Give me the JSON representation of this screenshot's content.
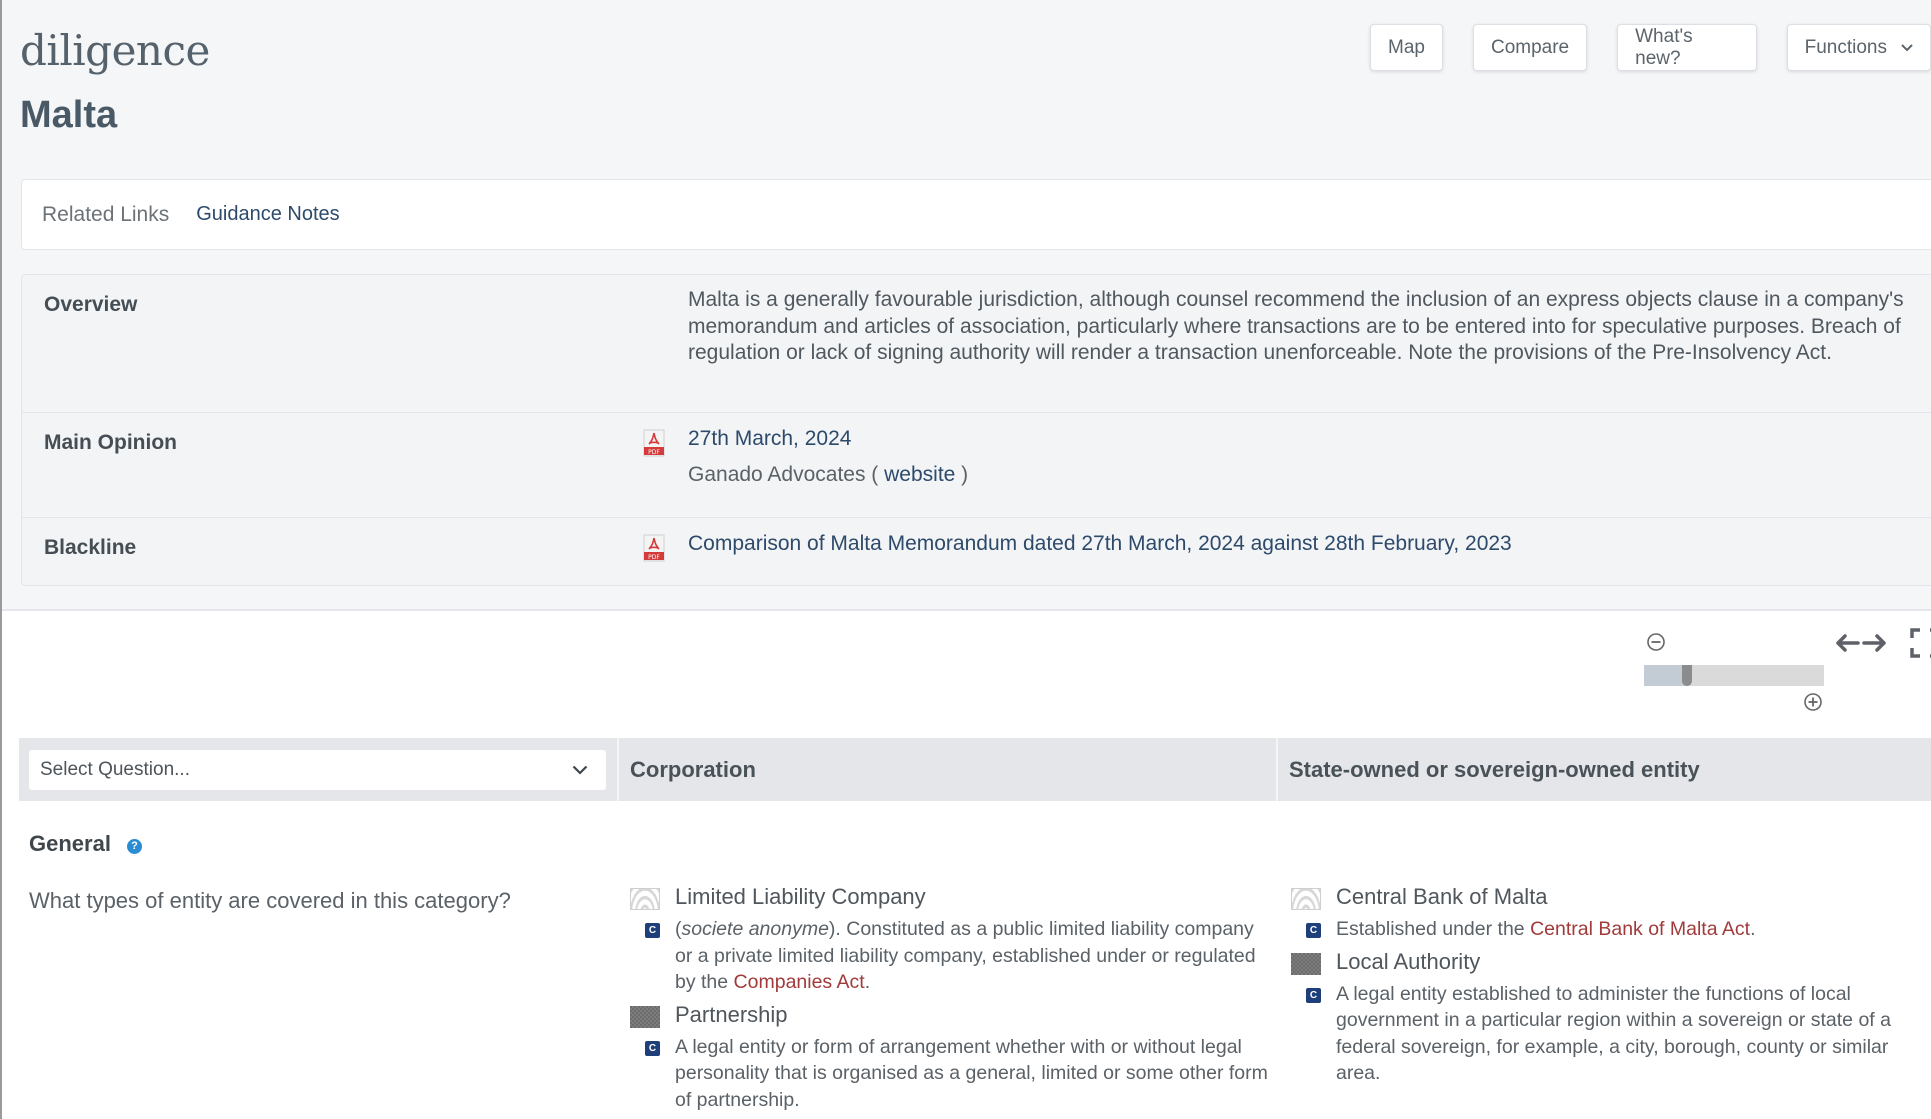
{
  "app": {
    "logo": "diligence",
    "page_title": "Malta"
  },
  "toolbar": {
    "map_label": "Map",
    "compare_label": "Compare",
    "whats_new_label": "What's new?",
    "functions_label": "Functions"
  },
  "related_links": {
    "label": "Related Links",
    "links": [
      {
        "label": "Guidance Notes"
      }
    ]
  },
  "info": {
    "overview": {
      "label": "Overview",
      "text": "Malta is a generally favourable jurisdiction, although counsel recommend the inclusion of an express objects clause in a company's memorandum and articles of association, particularly where transactions are to be entered into for speculative purposes. Breach of regulation or lack of signing authority will render a transaction unenforceable. Note the provisions of the Pre-Insolvency Act."
    },
    "main_opinion": {
      "label": "Main Opinion",
      "date": "27th March, 2024",
      "firm": "Ganado Advocates",
      "paren_open": " ( ",
      "website_label": "website",
      "paren_close": " )"
    },
    "blackline": {
      "label": "Blackline",
      "link": "Comparison of Malta Memorandum dated 27th March, 2024 against 28th February, 2023"
    }
  },
  "zoom": {
    "level_fraction": 0.24
  },
  "table": {
    "select_placeholder": "Select Question...",
    "columns": [
      "Corporation",
      "State-owned or sovereign-owned entity"
    ],
    "section": "General",
    "question": "What types of entity are covered in this category?",
    "answers": [
      {
        "entities": [
          {
            "name": "Limited Liability Company",
            "swatch": "light",
            "desc_italic": "societe anonyme",
            "desc_pre": "(",
            "desc_mid": "). Constituted as a public limited liability company or a private limited liability company, established under or regulated by the ",
            "desc_link": "Companies Act",
            "desc_post": "."
          },
          {
            "name": "Partnership",
            "swatch": "dark",
            "desc_text": "A legal entity or form of arrangement whether with or without legal personality that is organised as a general, limited or some other form of partnership."
          }
        ]
      },
      {
        "entities": [
          {
            "name": "Central Bank of Malta",
            "swatch": "light",
            "desc_pre": "Established under the ",
            "desc_link": "Central Bank of Malta Act",
            "desc_post": "."
          },
          {
            "name": "Local Authority",
            "swatch": "dark",
            "desc_text": "A legal entity established to administer the functions of local government in a particular region within a sovereign or state of a federal sovereign, for example, a city, borough, county or similar area."
          }
        ]
      }
    ],
    "badge_letter": "C"
  },
  "colors": {
    "link_blue": "#2d4a6b",
    "law_link_red": "#a13a3a",
    "badge_navy": "#1e3f7a",
    "help_blue": "#2a8dd4"
  }
}
